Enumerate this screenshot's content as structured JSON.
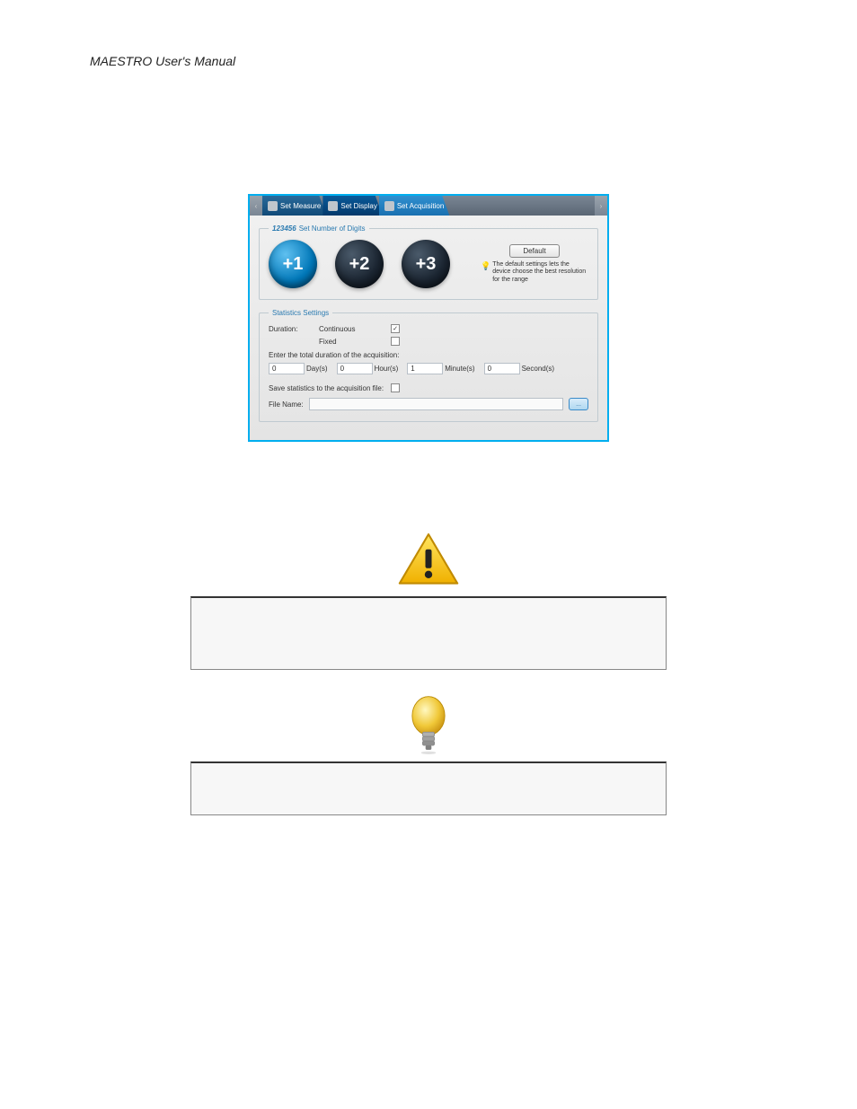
{
  "header": "MAESTRO User's Manual",
  "toolbar": {
    "arrow_left": "‹",
    "arrow_right": "›",
    "tab_measure": "Set Measure",
    "tab_display": "Set Display",
    "tab_acquisition": "Set Acquisition"
  },
  "digits": {
    "legend_icon": "123456",
    "legend": "Set Number of Digits",
    "b1": "+1",
    "b2": "+2",
    "b3": "+3",
    "default_btn": "Default",
    "default_text": "The default settings lets the device choose the best resolution for the range"
  },
  "stats": {
    "legend": "Statistics Settings",
    "duration": "Duration:",
    "continuous": "Continuous",
    "fixed": "Fixed",
    "note": "Enter the total duration of the acquisition:",
    "days_val": "0",
    "days": "Day(s)",
    "hours_val": "0",
    "hours": "Hour(s)",
    "minutes_val": "1",
    "minutes": "Minute(s)",
    "seconds_val": "0",
    "seconds": "Second(s)",
    "save_label": "Save statistics to the acquisition file:",
    "filename_label": "File Name:",
    "browse": "..."
  }
}
